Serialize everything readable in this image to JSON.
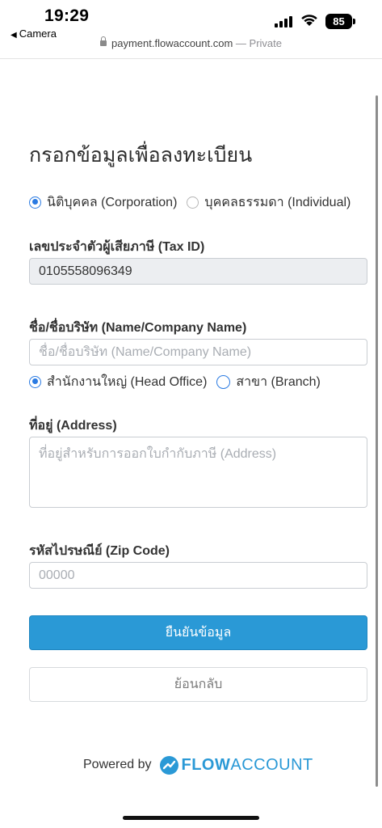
{
  "status_bar": {
    "time": "19:29",
    "back_app": "Camera",
    "battery": "85"
  },
  "browser": {
    "url": "payment.flowaccount.com",
    "mode": "— Private"
  },
  "form": {
    "title": "กรอกข้อมูลเพื่อลงทะเบียน",
    "entity_type": {
      "options": [
        "นิติบุคคล (Corporation)",
        "บุคคลธรรมดา (Individual)"
      ],
      "selected": "นิติบุคคล (Corporation)"
    },
    "tax_id": {
      "label": "เลขประจำตัวผู้เสียภาษี (Tax ID)",
      "value": "0105558096349"
    },
    "name": {
      "label": "ชื่อ/ชื่อบริษัท (Name/Company Name)",
      "placeholder": "ชื่อ/ชื่อบริษัท (Name/Company Name)"
    },
    "office_type": {
      "options": [
        "สำนักงานใหญ่ (Head Office)",
        "สาขา (Branch)"
      ],
      "selected": "สำนักงานใหญ่ (Head Office)"
    },
    "address": {
      "label": "ที่อยู่ (Address)",
      "placeholder": "ที่อยู่สำหรับการออกใบกำกับภาษี (Address)"
    },
    "zip": {
      "label": "รหัสไปรษณีย์ (Zip Code)",
      "placeholder": "00000"
    },
    "confirm_label": "ยืนยันข้อมูล",
    "back_label": "ย้อนกลับ"
  },
  "footer": {
    "powered_by": "Powered by",
    "brand_flow": "FLOW",
    "brand_account": "ACCOUNT"
  },
  "colors": {
    "accent": "#2a99d6",
    "radio": "#2a7ae2"
  }
}
